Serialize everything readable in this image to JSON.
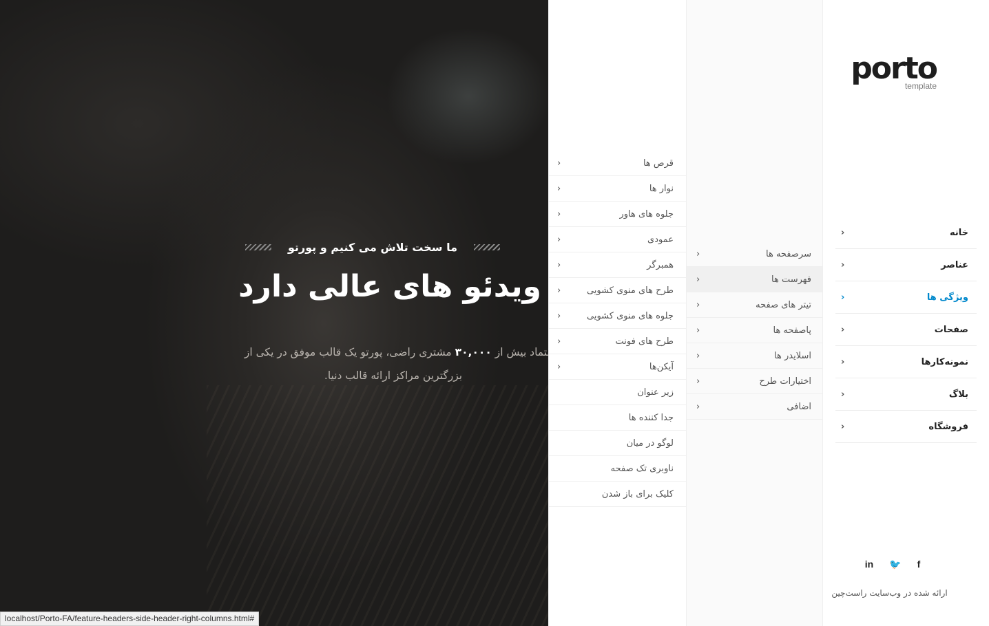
{
  "hero": {
    "tagline": "ما سخت تلاش می کنیم و پورتو",
    "title": "ویدئو های عالی دارد",
    "text_pre": "اعتماد بیش از",
    "text_bold": "۳۰,۰۰۰",
    "text_post": "مشتری راضی، پورتو یک قالب موفق در یکی از",
    "text_line2": "بزرگترین مراکز ارائه قالب دنیا."
  },
  "status_url": "localhost/Porto-FA/feature-headers-side-header-right-columns.html#",
  "logo": {
    "word": "porto",
    "sub": "template"
  },
  "main_nav": [
    {
      "label": "خانه",
      "active": false
    },
    {
      "label": "عناصر",
      "active": false
    },
    {
      "label": "ویژگی ها",
      "active": true
    },
    {
      "label": "صفحات",
      "active": false
    },
    {
      "label": "نمونه‌کارها",
      "active": false
    },
    {
      "label": "بلاگ",
      "active": false
    },
    {
      "label": "فروشگاه",
      "active": false
    }
  ],
  "features_submenu": [
    {
      "label": "سرصفحه ها"
    },
    {
      "label": "فهرست ها",
      "active": true
    },
    {
      "label": "تیتر های صفحه"
    },
    {
      "label": "پاصفحه ها"
    },
    {
      "label": "اسلایدر ها"
    },
    {
      "label": "اختیارات طرح"
    },
    {
      "label": "اضافی"
    }
  ],
  "menus_submenu": [
    {
      "label": "قرص ها",
      "arrow": true
    },
    {
      "label": "نوار ها",
      "arrow": true
    },
    {
      "label": "جلوه های هاور",
      "arrow": true
    },
    {
      "label": "عمودی",
      "arrow": true
    },
    {
      "label": "همبرگر",
      "arrow": true
    },
    {
      "label": "طرح های منوی کشویی",
      "arrow": true
    },
    {
      "label": "جلوه های منوی کشویی",
      "arrow": true
    },
    {
      "label": "طرح های فونت",
      "arrow": true
    },
    {
      "label": "آیکن‌ها",
      "arrow": true
    },
    {
      "label": "زیر عنوان",
      "arrow": false
    },
    {
      "label": "جدا کننده ها",
      "arrow": false
    },
    {
      "label": "لوگو در میان",
      "arrow": false
    },
    {
      "label": "ناوبری تک صفحه",
      "arrow": false
    },
    {
      "label": "کلیک برای باز شدن",
      "arrow": false
    }
  ],
  "social": [
    {
      "icon": "linkedin-icon",
      "glyph": "in"
    },
    {
      "icon": "twitter-icon",
      "glyph": "🐦"
    },
    {
      "icon": "facebook-icon",
      "glyph": "f"
    }
  ],
  "credit": "ارائه شده در وب‌سایت راست‌چین",
  "colors": {
    "accent": "#0088cc",
    "text": "#222222"
  }
}
